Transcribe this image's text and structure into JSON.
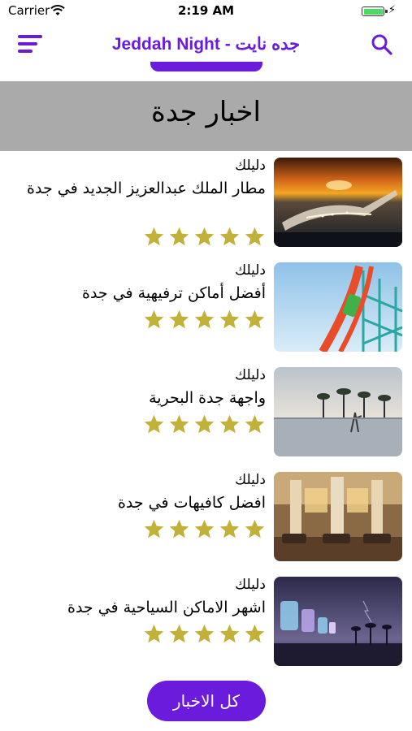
{
  "status_bar": {
    "carrier": "Carrier",
    "time": "2:19 AM"
  },
  "nav": {
    "title": "Jeddah Night - جده نايت",
    "menu_icon": "hamburger-menu-icon",
    "search_icon": "search-icon",
    "accent_color": "#6a1bdc"
  },
  "section": {
    "title": "اخبار جدة",
    "background": "#aaaaaa"
  },
  "items": [
    {
      "category": "دليلك",
      "title": "مطار الملك عبدالعزيز الجديد في جدة",
      "rating": 5,
      "image": "airport-photo"
    },
    {
      "category": "دليلك",
      "title": "أفضل أماكن ترفيهية في جدة",
      "rating": 5,
      "image": "rollercoaster-photo"
    },
    {
      "category": "دليلك",
      "title": "واجهة جدة البحرية",
      "rating": 5,
      "image": "waterfront-photo"
    },
    {
      "category": "دليلك",
      "title": "افضل كافيهات في جدة",
      "rating": 5,
      "image": "cafe-interior-photo"
    },
    {
      "category": "دليلك",
      "title": "اشهر الاماكن السياحية في جدة",
      "rating": 5,
      "image": "night-lanterns-photo"
    }
  ],
  "star_color": "#c1b138",
  "footer": {
    "all_news_label": "كل الاخبار"
  }
}
